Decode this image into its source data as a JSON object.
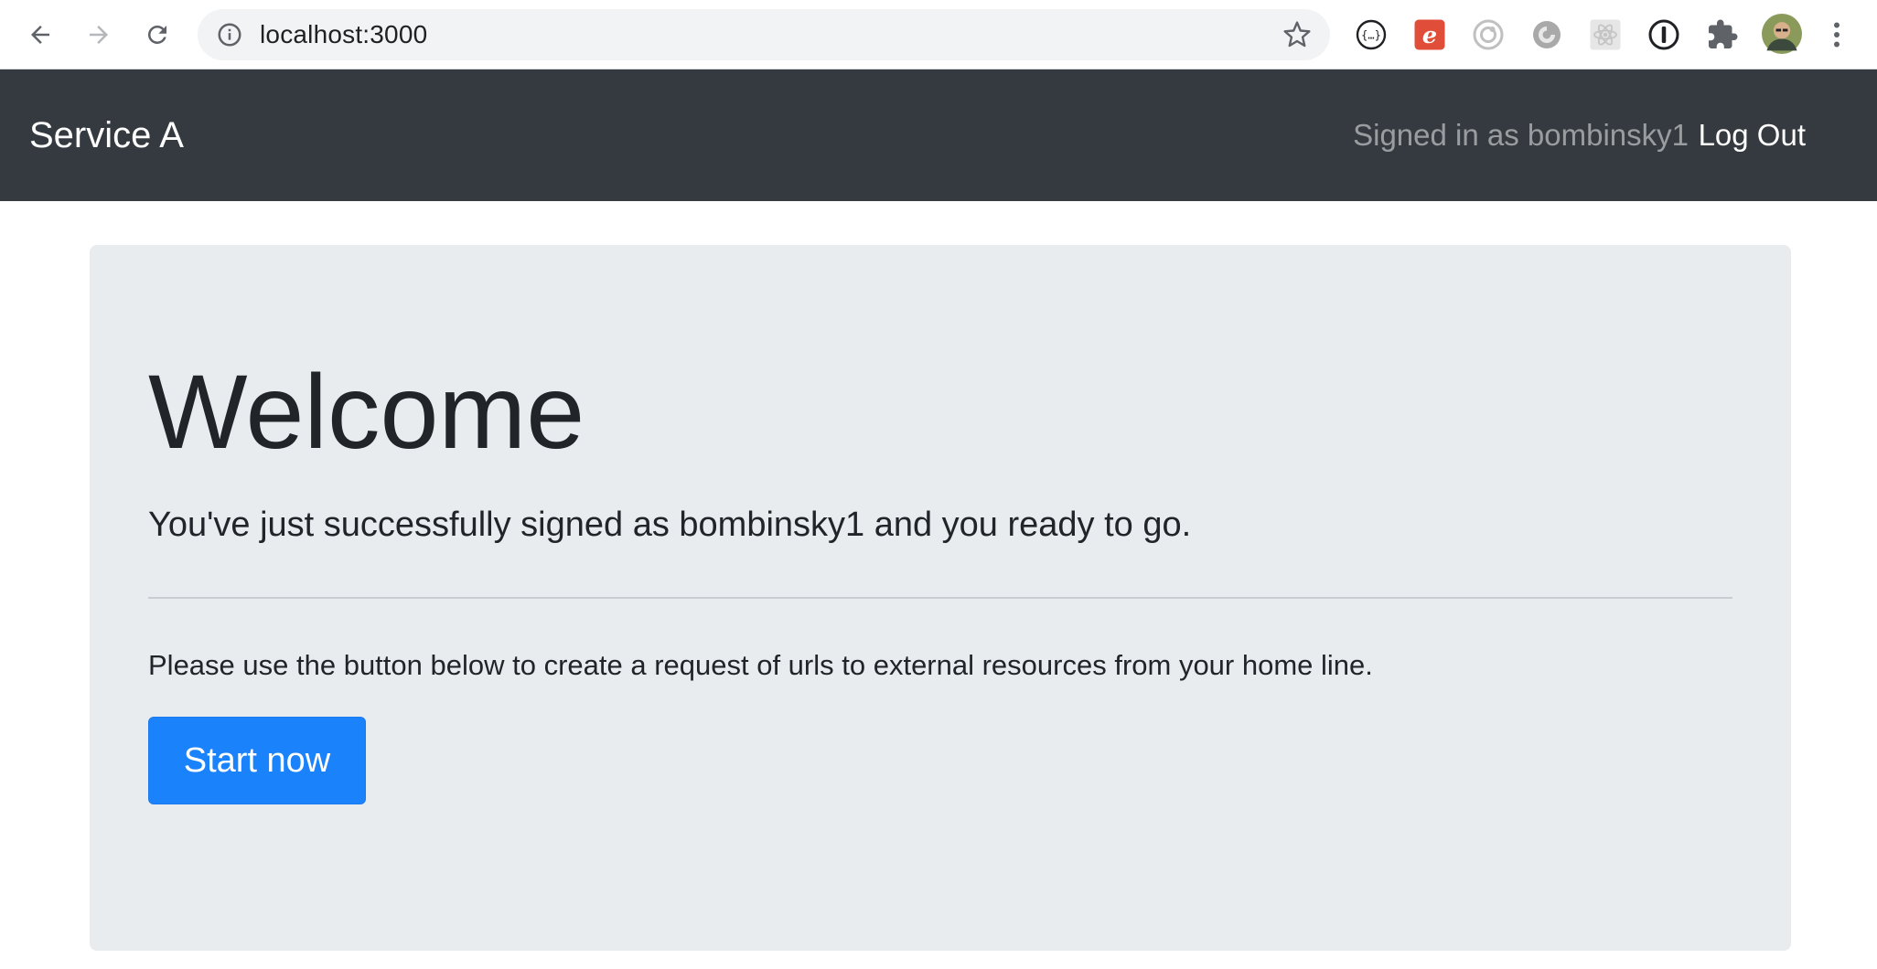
{
  "browser": {
    "url": "localhost:3000",
    "nav_icons": [
      "back-arrow-icon",
      "forward-arrow-icon",
      "reload-icon"
    ],
    "extensions": [
      "json-viewer-icon",
      "e-extension-icon",
      "circle-extension-icon",
      "swirl-extension-icon",
      "react-devtools-icon",
      "password-manager-icon",
      "puzzle-extensions-icon",
      "profile-avatar",
      "kebab-menu-icon"
    ]
  },
  "navbar": {
    "brand": "Service A",
    "signed_in_text": "Signed in as bombinsky1",
    "logout_label": "Log Out",
    "background": "#343a40"
  },
  "jumbotron": {
    "heading": "Welcome",
    "lead": "You've just successfully signed as bombinsky1 and you ready to go.",
    "body": "Please use the button below to create a request of urls to external resources from your home line.",
    "button_label": "Start now",
    "background": "#e9ecef",
    "button_color": "#1a82fb"
  }
}
